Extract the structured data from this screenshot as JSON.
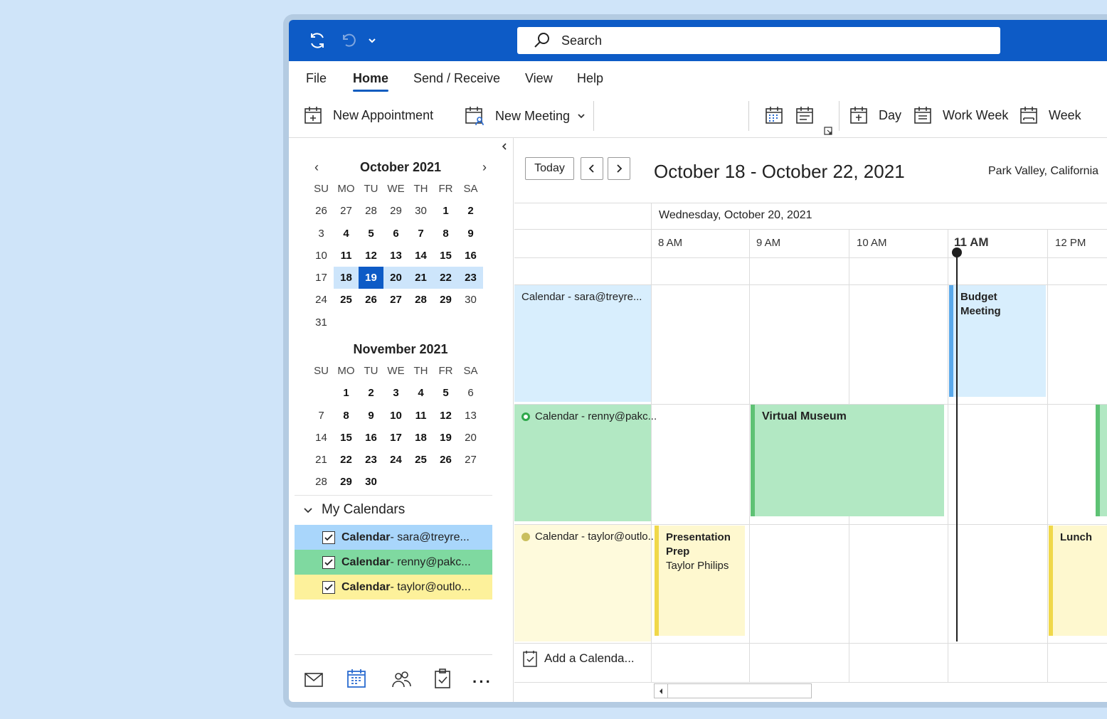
{
  "titlebar": {
    "search_placeholder": "Search",
    "accent": "#0d5bc6"
  },
  "menu": [
    "File",
    "Home",
    "Send / Receive",
    "View",
    "Help"
  ],
  "menu_active": "Home",
  "ribbon": {
    "new_appointment": "New Appointment",
    "new_meeting": "New Meeting",
    "day": "Day",
    "work_week": "Work Week",
    "week": "Week"
  },
  "mini_calendars": [
    {
      "title": "October 2021",
      "dow": [
        "SU",
        "MO",
        "TU",
        "WE",
        "TH",
        "FR",
        "SA"
      ],
      "days": [
        "26",
        "27",
        "28",
        "29",
        "30",
        "1",
        "2",
        "3",
        "4",
        "5",
        "6",
        "7",
        "8",
        "9",
        "10",
        "11",
        "12",
        "13",
        "14",
        "15",
        "16",
        "17",
        "18",
        "19",
        "20",
        "21",
        "22",
        "23",
        "24",
        "25",
        "26",
        "27",
        "28",
        "29",
        "30",
        "31"
      ],
      "today": "20"
    },
    {
      "title": "November 2021",
      "dow": [
        "SU",
        "MO",
        "TU",
        "WE",
        "TH",
        "FR",
        "SA"
      ],
      "days": [
        "",
        "1",
        "2",
        "3",
        "4",
        "5",
        "6",
        "7",
        "8",
        "9",
        "10",
        "11",
        "12",
        "13",
        "14",
        "15",
        "16",
        "17",
        "18",
        "19",
        "20",
        "21",
        "22",
        "23",
        "24",
        "25",
        "26",
        "27",
        "28",
        "29",
        "30"
      ]
    }
  ],
  "my_calendars": {
    "header": "My Calendars",
    "items": [
      {
        "name": "Calendar",
        "account": " - sara@treyre...",
        "color": "#a9d6fb",
        "checked": true
      },
      {
        "name": "Calendar",
        "account": " - renny@pakc...",
        "color": "#7fd9a0",
        "checked": true
      },
      {
        "name": "Calendar",
        "account": " - taylor@outlo...",
        "color": "#fdf19b",
        "checked": true
      }
    ]
  },
  "calendar_view": {
    "today_button": "Today",
    "date_range": "October 18 - October 22, 2021",
    "location": "Park Valley, California",
    "day_header": "Wednesday, October 20, 2021",
    "hours": [
      "8 AM",
      "9 AM",
      "10 AM",
      "11 AM",
      "12 PM"
    ],
    "current_hour": "11 AM",
    "rows": [
      {
        "label": "Calendar - sara@treyre...",
        "bg": "#d8eefd"
      },
      {
        "label": "Calendar - renny@pakc...",
        "bg": "#b2e8c3",
        "dot": "#2ea84a"
      },
      {
        "label": "Calendar - taylor@outlo...",
        "bg": "#fefadc",
        "dot": "#c9bf5e"
      }
    ],
    "events": {
      "budget_meeting": "Budget Meeting",
      "virtual_museum": "Virtual Museum",
      "presentation_prep": "Presentation Prep",
      "presentation_prep_person": "Taylor Philips",
      "lunch": "Lunch"
    },
    "add_calendar": "Add a Calenda..."
  }
}
